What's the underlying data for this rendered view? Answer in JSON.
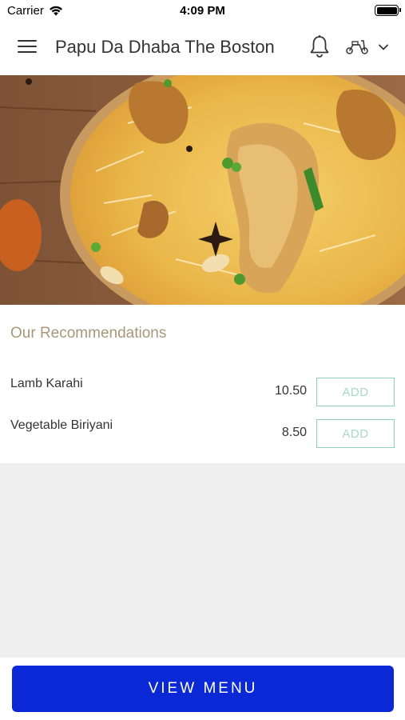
{
  "status_bar": {
    "carrier": "Carrier",
    "time": "4:09 PM"
  },
  "header": {
    "title": "Papu Da Dhaba The Boston"
  },
  "recommendations": {
    "heading": "Our Recommendations",
    "items": [
      {
        "name": "Lamb Karahi",
        "price": "10.50",
        "add_label": "ADD"
      },
      {
        "name": "Vegetable Biriyani",
        "price": "8.50",
        "add_label": "ADD"
      }
    ]
  },
  "footer": {
    "view_menu_label": "VIEW MENU"
  },
  "colors": {
    "primary_button": "#0a28d6",
    "heading": "#a9977a",
    "add_border": "#8fd1bd"
  },
  "icons": [
    "hamburger-menu-icon",
    "bell-icon",
    "scooter-icon",
    "chevron-down-icon",
    "wifi-icon",
    "battery-icon"
  ]
}
